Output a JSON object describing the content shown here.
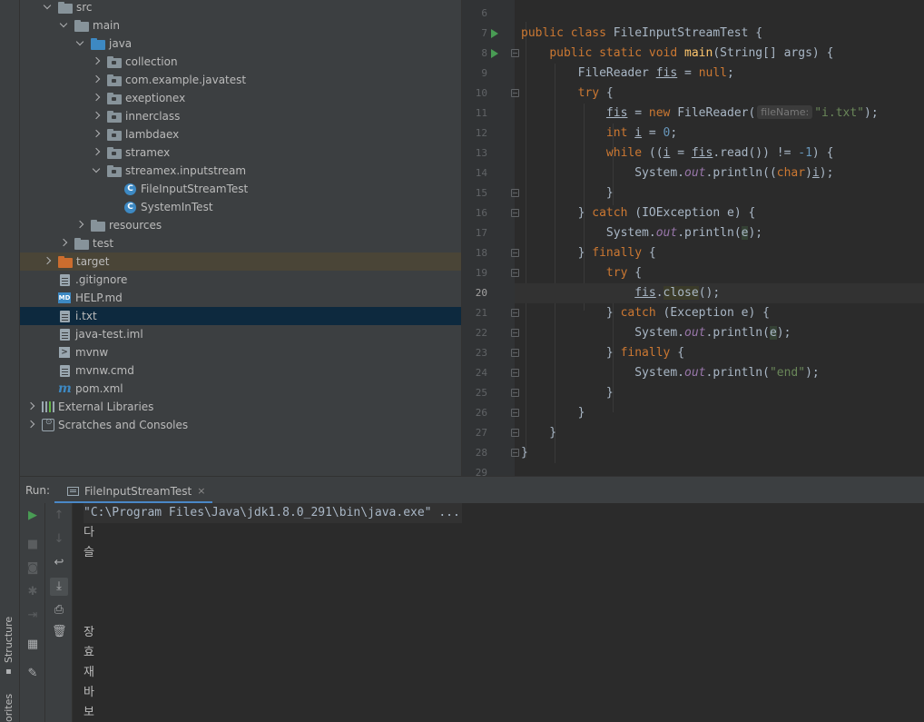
{
  "side_strip": {
    "structure_label": "Structure",
    "favorites_label": "orites"
  },
  "project_tree": [
    {
      "label": "src",
      "depth": 1,
      "arrow": "down",
      "icon": "folder"
    },
    {
      "label": "main",
      "depth": 2,
      "arrow": "down",
      "icon": "folder"
    },
    {
      "label": "java",
      "depth": 3,
      "arrow": "down",
      "icon": "folder-blue"
    },
    {
      "label": "collection",
      "depth": 4,
      "arrow": "right",
      "icon": "package"
    },
    {
      "label": "com.example.javatest",
      "depth": 4,
      "arrow": "right",
      "icon": "package"
    },
    {
      "label": "exeptionex",
      "depth": 4,
      "arrow": "right",
      "icon": "package"
    },
    {
      "label": "innerclass",
      "depth": 4,
      "arrow": "right",
      "icon": "package"
    },
    {
      "label": "lambdaex",
      "depth": 4,
      "arrow": "right",
      "icon": "package"
    },
    {
      "label": "stramex",
      "depth": 4,
      "arrow": "right",
      "icon": "package"
    },
    {
      "label": "streamex.inputstream",
      "depth": 4,
      "arrow": "down",
      "icon": "package"
    },
    {
      "label": "FileInputStreamTest",
      "depth": 5,
      "arrow": "none",
      "icon": "class"
    },
    {
      "label": "SystemInTest",
      "depth": 5,
      "arrow": "none",
      "icon": "class"
    },
    {
      "label": "resources",
      "depth": 3,
      "arrow": "right",
      "icon": "folder"
    },
    {
      "label": "test",
      "depth": 2,
      "arrow": "right",
      "icon": "folder"
    },
    {
      "label": "target",
      "depth": 1,
      "arrow": "right",
      "icon": "folder-orange",
      "selected": "target"
    },
    {
      "label": ".gitignore",
      "depth": 1,
      "arrow": "none",
      "icon": "file"
    },
    {
      "label": "HELP.md",
      "depth": 1,
      "arrow": "none",
      "icon": "md"
    },
    {
      "label": "i.txt",
      "depth": 1,
      "arrow": "none",
      "icon": "file",
      "selected": "itxt"
    },
    {
      "label": "java-test.iml",
      "depth": 1,
      "arrow": "none",
      "icon": "file"
    },
    {
      "label": "mvnw",
      "depth": 1,
      "arrow": "none",
      "icon": "terminal"
    },
    {
      "label": "mvnw.cmd",
      "depth": 1,
      "arrow": "none",
      "icon": "file"
    },
    {
      "label": "pom.xml",
      "depth": 1,
      "arrow": "none",
      "icon": "maven"
    },
    {
      "label": "External Libraries",
      "depth": 0,
      "arrow": "right",
      "icon": "library"
    },
    {
      "label": "Scratches and Consoles",
      "depth": 0,
      "arrow": "right",
      "icon": "scratch"
    }
  ],
  "editor": {
    "line_numbers": [
      "6",
      "7",
      "8",
      "9",
      "10",
      "11",
      "12",
      "13",
      "14",
      "15",
      "16",
      "17",
      "18",
      "19",
      "20",
      "21",
      "22",
      "23",
      "24",
      "25",
      "26",
      "27",
      "28",
      "29"
    ],
    "current_line": "20",
    "param_hint": "fileName:"
  },
  "run_panel": {
    "title": "Run:",
    "tab_label": "FileInputStreamTest",
    "tab_close": "×",
    "console_lines": [
      "\"C:\\Program Files\\Java\\jdk1.8.0_291\\bin\\java.exe\" ...",
      "다",
      "슬",
      "",
      "",
      "",
      "장",
      "효",
      "재",
      "바",
      "보"
    ]
  }
}
